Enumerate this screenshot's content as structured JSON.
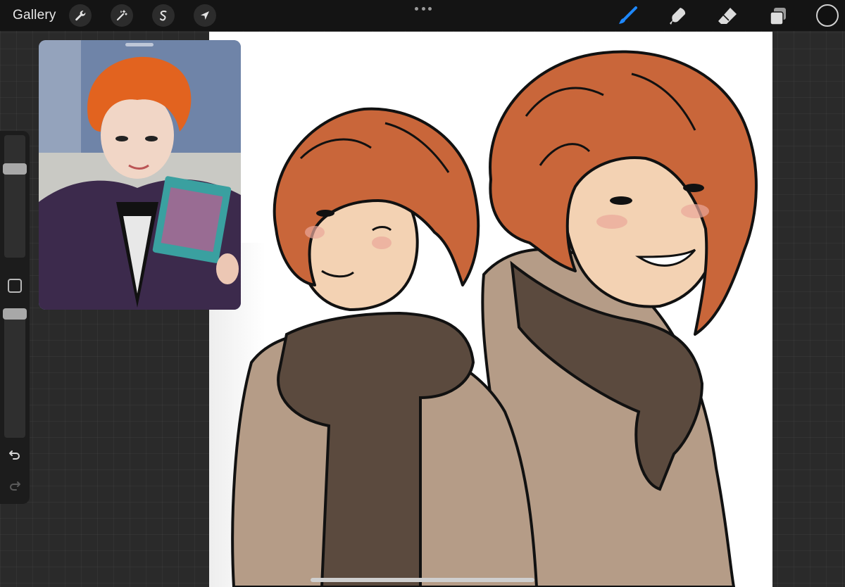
{
  "topbar": {
    "gallery_label": "Gallery",
    "left_tools": [
      {
        "name": "actions",
        "icon": "wrench-icon"
      },
      {
        "name": "adjustments",
        "icon": "magic-wand-icon"
      },
      {
        "name": "selection",
        "icon": "selection-icon"
      },
      {
        "name": "transform",
        "icon": "arrow-cursor-icon"
      }
    ],
    "right_tools": [
      {
        "name": "brush",
        "icon": "brush-icon",
        "active": true
      },
      {
        "name": "smudge",
        "icon": "smudge-icon",
        "active": false
      },
      {
        "name": "eraser",
        "icon": "eraser-icon",
        "active": false
      },
      {
        "name": "layers",
        "icon": "layers-icon",
        "active": false
      }
    ],
    "current_color": "#111111",
    "active_color": "#1e88ff"
  },
  "sidebar": {
    "brush_size_level": 0.75,
    "opacity_level": 1.0,
    "modify_icon": "square-icon",
    "undo_icon": "undo-arrow-icon",
    "redo_icon": "redo-arrow-icon"
  },
  "reference_window": {
    "content": "reference-photo"
  },
  "canvas": {
    "background": "#ffffff",
    "palette": {
      "hair": "#c9663a",
      "hair_shadow": "#b0552f",
      "skin": "#f3d2b3",
      "blush": "#eaa69a",
      "scarf": "#5b4a3e",
      "coat": "#b59c87",
      "line": "#111111"
    }
  }
}
